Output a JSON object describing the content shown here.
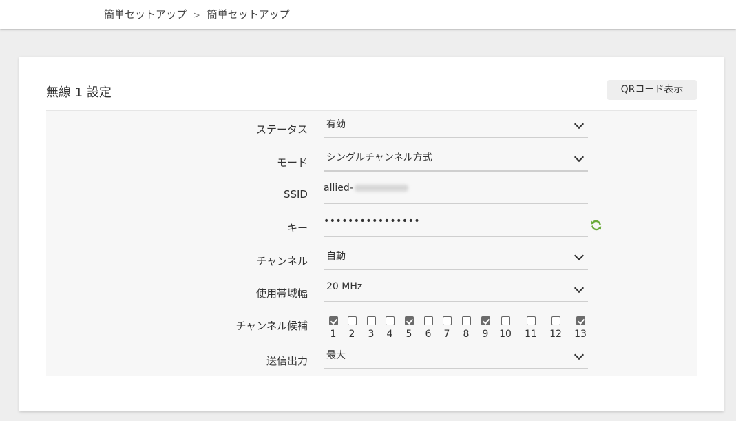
{
  "breadcrumb": {
    "items": [
      "簡単セットアップ",
      "簡単セットアップ"
    ],
    "separator": ">"
  },
  "card": {
    "title": "無線 1 設定",
    "qr_button_label": "QRコード表示"
  },
  "form": {
    "status": {
      "label": "ステータス",
      "value": "有効"
    },
    "mode": {
      "label": "モード",
      "value": "シングルチャンネル方式"
    },
    "ssid": {
      "label": "SSID",
      "value": "allied-"
    },
    "key": {
      "label": "キー",
      "value": "••••••••••••••••"
    },
    "channel": {
      "label": "チャンネル",
      "value": "自動"
    },
    "bandwidth": {
      "label": "使用帯域幅",
      "value": "20 MHz"
    },
    "channel_candidates": {
      "label": "チャンネル候補",
      "items": [
        {
          "num": "1",
          "checked": true
        },
        {
          "num": "2",
          "checked": false
        },
        {
          "num": "3",
          "checked": false
        },
        {
          "num": "4",
          "checked": false
        },
        {
          "num": "5",
          "checked": true
        },
        {
          "num": "6",
          "checked": false
        },
        {
          "num": "7",
          "checked": false
        },
        {
          "num": "8",
          "checked": false
        },
        {
          "num": "9",
          "checked": true
        },
        {
          "num": "10",
          "checked": false
        },
        {
          "num": "11",
          "checked": false
        },
        {
          "num": "12",
          "checked": false
        },
        {
          "num": "13",
          "checked": true
        }
      ]
    },
    "tx_power": {
      "label": "送信出力",
      "value": "最大"
    }
  },
  "icons": {
    "chevron": "chevron-down-icon",
    "refresh": "refresh-icon"
  },
  "colors": {
    "refresh_icon": "#6aaa3a",
    "checkbox_checked": "#6b6b6b"
  }
}
